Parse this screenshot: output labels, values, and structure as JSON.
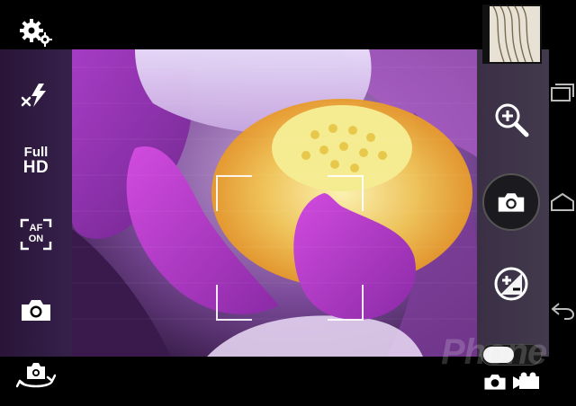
{
  "left_controls": {
    "settings_icon": "gear-icon",
    "flash_icon": "flash-off-icon",
    "resolution": {
      "line1": "Full",
      "line2": "HD"
    },
    "af_icon": {
      "line1": "AF",
      "line2": "ON"
    },
    "capture_mode_icon": "camera-icon",
    "switch_camera_icon": "switch-camera-icon"
  },
  "right_controls": {
    "zoom_in_icon": "zoom-in-icon",
    "shutter_icon": "camera-icon",
    "exposure_icon": "exposure-icon",
    "mode_toggle": {
      "selected": "photo"
    },
    "mode_photo_icon": "camera-icon",
    "mode_video_icon": "video-camera-icon"
  },
  "navigation": {
    "recent_icon": "recent-apps-icon",
    "home_icon": "home-icon",
    "back_icon": "back-icon"
  },
  "watermark": "Phone",
  "colors": {
    "accent": "#9b2fb5",
    "pollen": "#f0c64a"
  }
}
